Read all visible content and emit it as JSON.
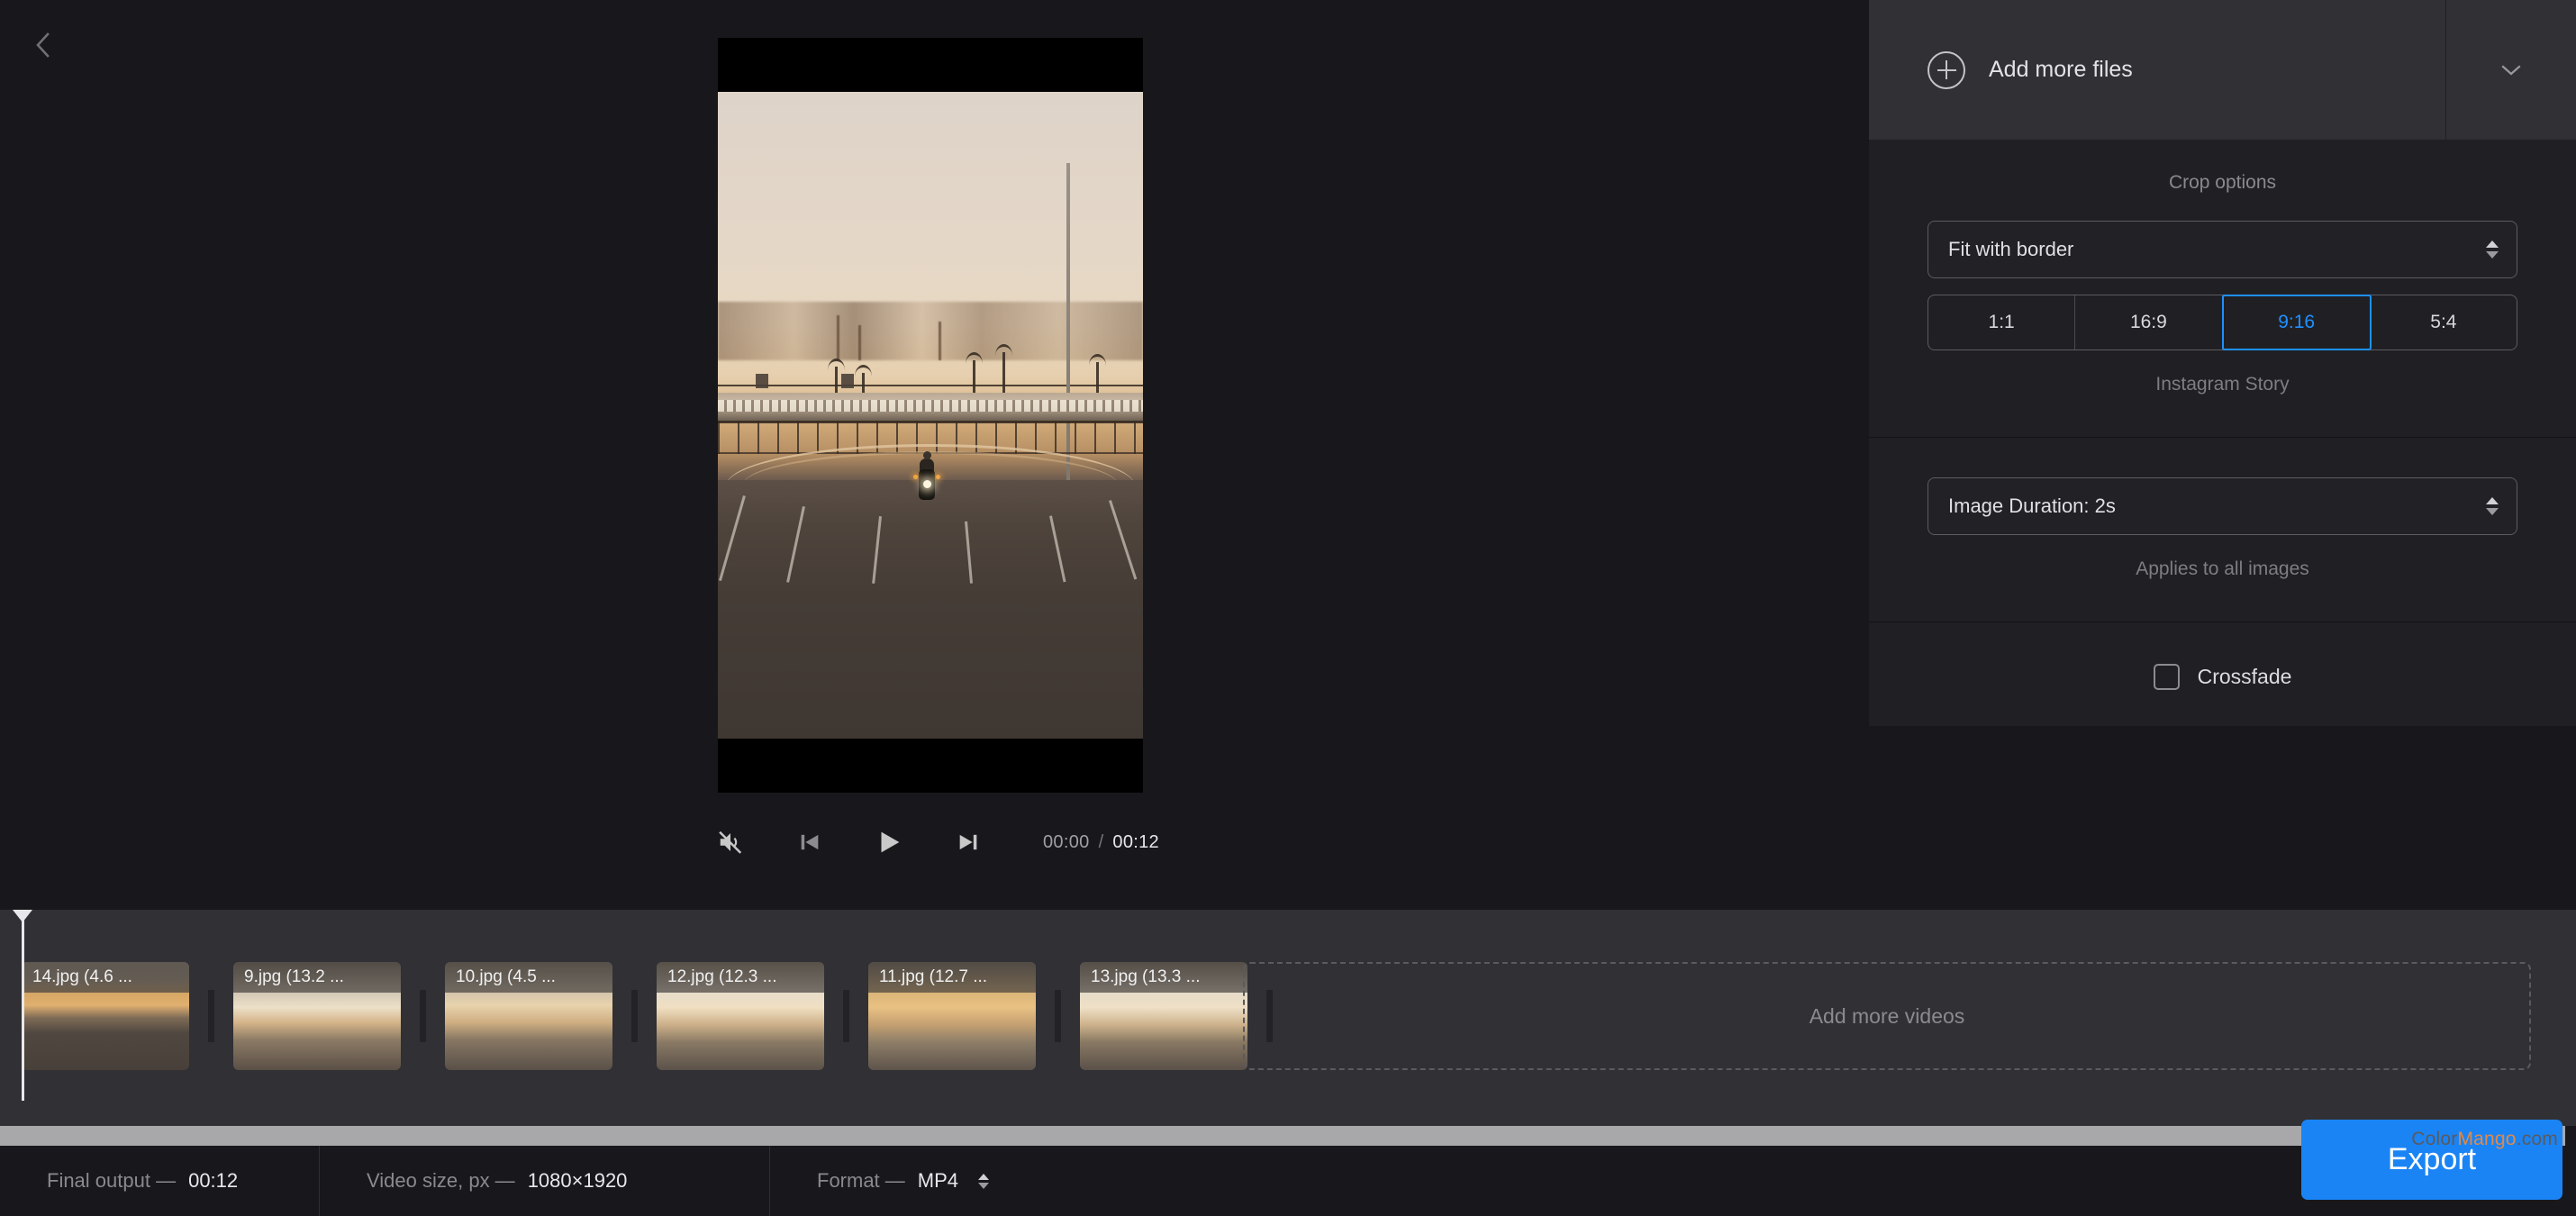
{
  "nav": {
    "back_icon": "chevron-left-icon"
  },
  "preview": {
    "scene_description": "Motorcycle rider on empty road under ornate bridge at sunset",
    "letterbox": true
  },
  "player": {
    "mute_icon": "volume-mute-icon",
    "prev_icon": "skip-previous-icon",
    "play_icon": "play-icon",
    "next_icon": "skip-next-icon",
    "current_time": "00:00",
    "separator": "/",
    "total_time": "00:12"
  },
  "sidebar": {
    "header": {
      "add_files_label": "Add more files",
      "plus_icon": "plus-circle-icon",
      "collapse_icon": "chevron-down-icon"
    },
    "crop": {
      "title": "Crop options",
      "mode_value": "Fit with border",
      "ratios": [
        {
          "label": "1:1",
          "active": false
        },
        {
          "label": "16:9",
          "active": false
        },
        {
          "label": "9:16",
          "active": true
        },
        {
          "label": "5:4",
          "active": false
        }
      ],
      "preset_caption": "Instagram Story",
      "accent_color": "#1e90ff"
    },
    "duration": {
      "value": "Image Duration: 2s",
      "caption": "Applies to all images"
    },
    "crossfade": {
      "label": "Crossfade",
      "checked": false
    }
  },
  "timeline": {
    "clips": [
      {
        "title": "14.jpg (4.6 ..."
      },
      {
        "title": "9.jpg (13.2 ..."
      },
      {
        "title": "10.jpg (4.5 ..."
      },
      {
        "title": "12.jpg (12.3 ..."
      },
      {
        "title": "11.jpg (12.7 ..."
      },
      {
        "title": "13.jpg (13.3 ..."
      }
    ],
    "add_videos_label": "Add more videos"
  },
  "status": {
    "final_output_label": "Final output —",
    "final_output_value": "00:12",
    "video_size_label": "Video size, px —",
    "video_size_value": "1080×1920",
    "format_label": "Format —",
    "format_value": "MP4"
  },
  "export": {
    "label": "Export"
  },
  "watermark": {
    "part1": "Color",
    "part2": "Mango",
    "part3": ".com"
  }
}
